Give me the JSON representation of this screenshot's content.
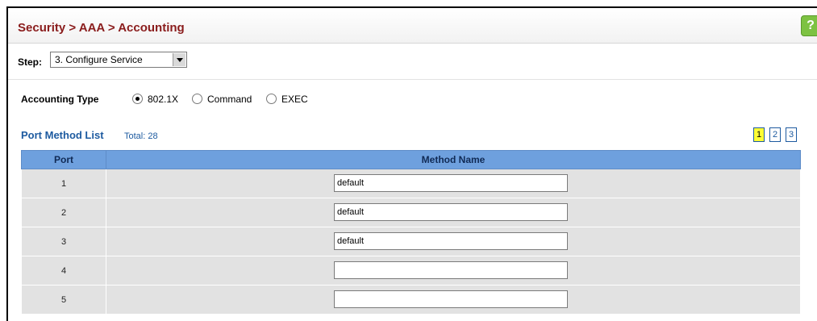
{
  "header": {
    "title": "Security > AAA > Accounting",
    "help_icon": "help-icon"
  },
  "step": {
    "label": "Step:",
    "selected": "3. Configure Service"
  },
  "accounting_type": {
    "label": "Accounting Type",
    "options": [
      {
        "label": "802.1X",
        "checked": true
      },
      {
        "label": "Command",
        "checked": false
      },
      {
        "label": "EXEC",
        "checked": false
      }
    ]
  },
  "port_method_list": {
    "title": "Port Method List",
    "total": "Total: 28",
    "pages": [
      "1",
      "2",
      "3"
    ],
    "current_page": "1",
    "columns": [
      "Port",
      "Method Name"
    ],
    "rows": [
      {
        "port": "1",
        "method": "default"
      },
      {
        "port": "2",
        "method": "default"
      },
      {
        "port": "3",
        "method": "default"
      },
      {
        "port": "4",
        "method": ""
      },
      {
        "port": "5",
        "method": ""
      }
    ]
  },
  "colors": {
    "title": "#8a1c1c",
    "link": "#1e5ba0",
    "table_header": "#6ea0de",
    "row_bg": "#e2e2e2",
    "current_page": "#ffff33"
  }
}
